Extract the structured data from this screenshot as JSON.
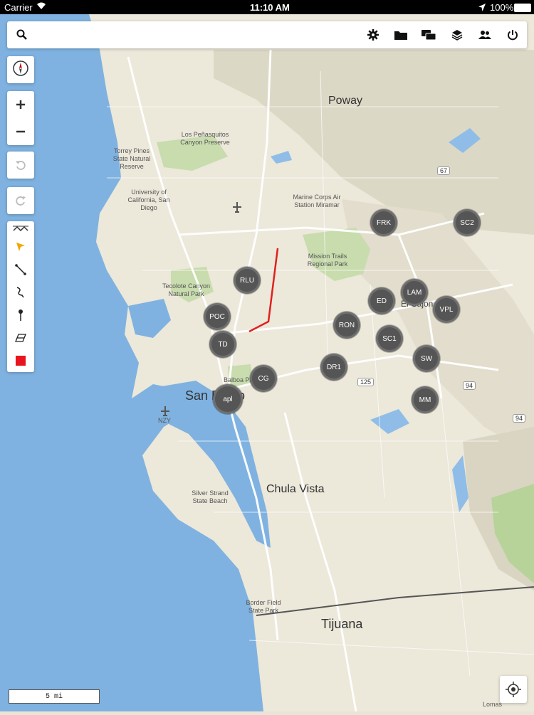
{
  "status_bar": {
    "carrier": "Carrier",
    "time": "11:10 AM",
    "battery": "100%"
  },
  "toolbar": {
    "icons": [
      "search-icon",
      "settings-icon",
      "folder-icon",
      "chat-icon",
      "layers-icon",
      "users-icon",
      "power-icon"
    ]
  },
  "map": {
    "places": {
      "poway": "Poway",
      "los_penasquitos": "Los Peñasquitos Canyon Preserve",
      "torrey_pines": "Torrey Pines State Natural Reserve",
      "ucsd": "University of California, San Diego",
      "marine_corps": "Marine Corps Air Station Miramar",
      "mission_trails": "Mission Trails Regional Park",
      "tecolote": "Tecolote Canyon Natural Park",
      "el_cajon": "El Cajon",
      "balboa": "Balboa Park",
      "san_diego": "San Diego",
      "nzy": "NZY",
      "silver_strand": "Silver Strand State Beach",
      "chula_vista": "Chula Vista",
      "border_field": "Border Field State Park",
      "tijuana": "Tijuana",
      "lomas": "Lomas"
    },
    "highways": {
      "h67": "67",
      "h125": "125",
      "h94a": "94",
      "h94b": "94"
    },
    "markers": [
      "FRK",
      "SC2",
      "RLU",
      "LAM",
      "ED",
      "VPL",
      "POC",
      "RON",
      "SC1",
      "TD",
      "DR1",
      "SW",
      "CG",
      "apl",
      "MM"
    ],
    "colors": {
      "water": "#7fb2e0",
      "land": "#ece8da",
      "park": "#c8dcae",
      "route": "#e02020",
      "marker": "#555555",
      "active_color": "#e8141e"
    },
    "scale_label": "5 mi"
  }
}
